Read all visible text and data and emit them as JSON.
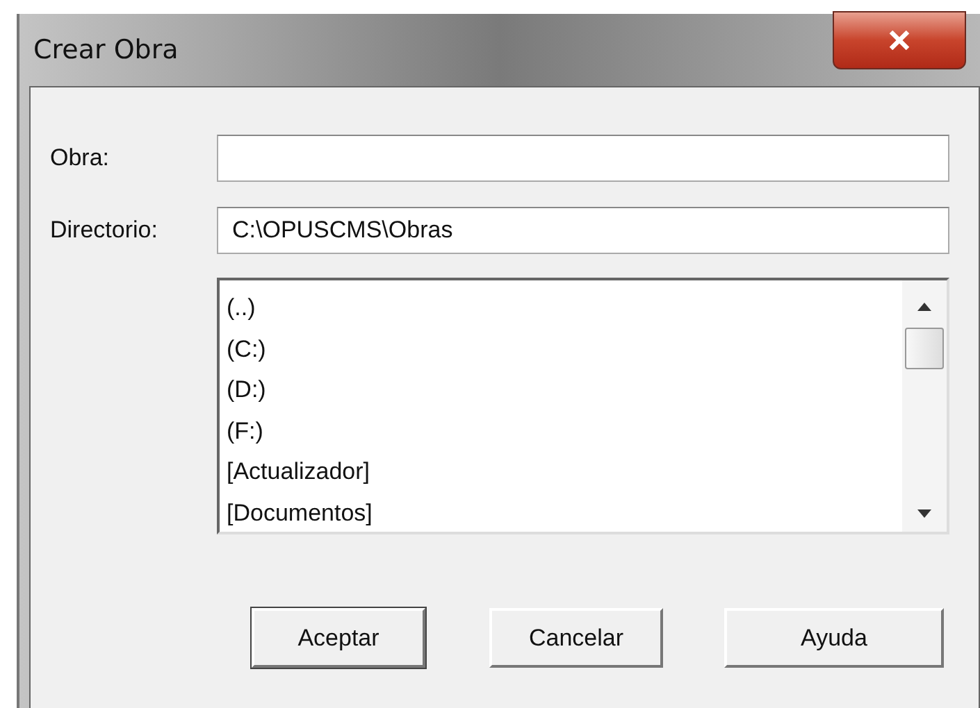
{
  "window": {
    "title": "Crear Obra"
  },
  "fields": [
    {
      "label": "Obra:"
    },
    {
      "label": "Directorio:",
      "value": "C:\\OPUSCMS\\Obras"
    }
  ],
  "list": {
    "items": [
      "(..)",
      "(C:)",
      "(D:)",
      "(F:)",
      "[Actualizador]",
      "[Documentos]"
    ]
  },
  "buttons": [
    {
      "label": "Aceptar",
      "default": true
    },
    {
      "label": "Cancelar",
      "default": false
    },
    {
      "label": "Ayuda",
      "default": false
    }
  ]
}
